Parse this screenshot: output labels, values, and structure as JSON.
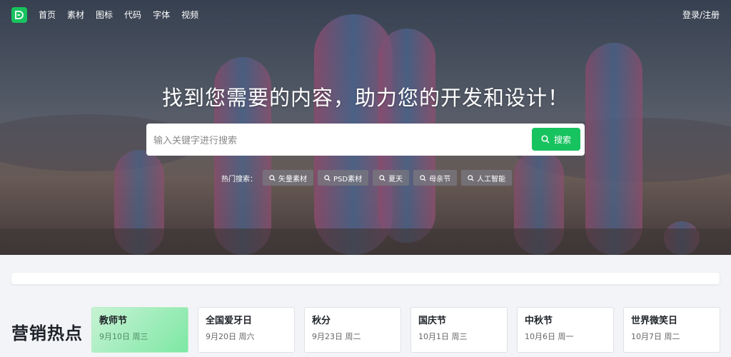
{
  "nav": {
    "links": [
      "首页",
      "素材",
      "图标",
      "代码",
      "字体",
      "视频"
    ],
    "login_label": "登录/注册"
  },
  "hero": {
    "headline": "找到您需要的内容，助力您的开发和设计！",
    "search": {
      "placeholder": "输入关键字进行搜索",
      "value": "",
      "button_label": "搜索"
    },
    "hot_label": "热门搜索：",
    "hot_tags": [
      "矢量素材",
      "PSD素材",
      "夏天",
      "母亲节",
      "人工智能"
    ]
  },
  "marketing": {
    "title": "营销热点",
    "cards": [
      {
        "title": "教师节",
        "date": "9月10日 周三",
        "active": true
      },
      {
        "title": "全国爱牙日",
        "date": "9月20日 周六"
      },
      {
        "title": "秋分",
        "date": "9月23日 周二"
      },
      {
        "title": "国庆节",
        "date": "10月1日 周三"
      },
      {
        "title": "中秋节",
        "date": "10月6日 周一"
      },
      {
        "title": "世界微笑日",
        "date": "10月7日 周二"
      }
    ]
  },
  "colors": {
    "accent": "#17c35f"
  }
}
